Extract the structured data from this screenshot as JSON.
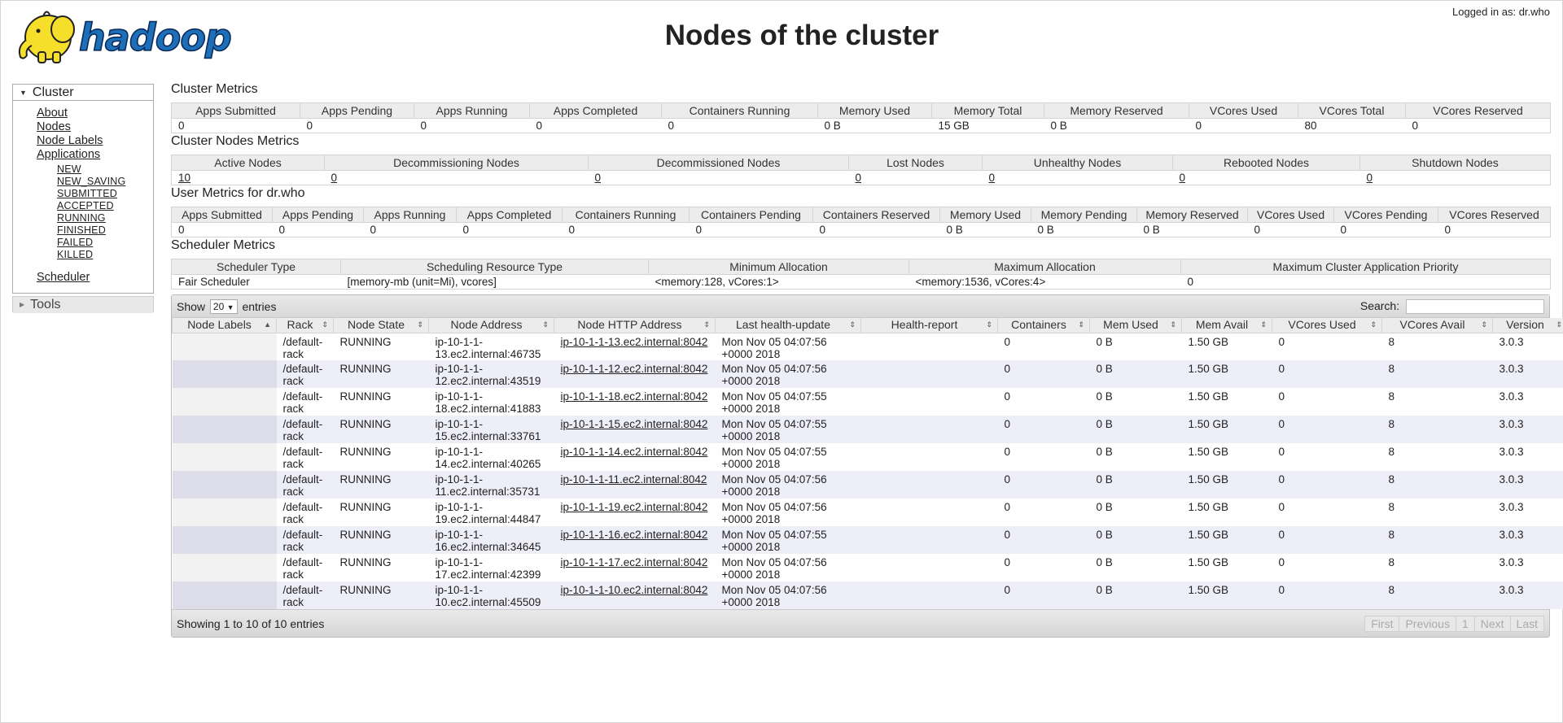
{
  "header": {
    "logo_text": "hadoop",
    "title": "Nodes of the cluster",
    "logged_in": "Logged in as: dr.who"
  },
  "sidebar": {
    "cluster_label": "Cluster",
    "items": [
      "About",
      "Nodes",
      "Node Labels",
      "Applications"
    ],
    "app_states": [
      "NEW",
      "NEW_SAVING",
      "SUBMITTED",
      "ACCEPTED",
      "RUNNING",
      "FINISHED",
      "FAILED",
      "KILLED"
    ],
    "scheduler_label": "Scheduler",
    "tools_label": "Tools"
  },
  "cluster_metrics": {
    "title": "Cluster Metrics",
    "headers": [
      "Apps Submitted",
      "Apps Pending",
      "Apps Running",
      "Apps Completed",
      "Containers Running",
      "Memory Used",
      "Memory Total",
      "Memory Reserved",
      "VCores Used",
      "VCores Total",
      "VCores Reserved"
    ],
    "values": [
      "0",
      "0",
      "0",
      "0",
      "0",
      "0 B",
      "15 GB",
      "0 B",
      "0",
      "80",
      "0"
    ]
  },
  "node_metrics": {
    "title": "Cluster Nodes Metrics",
    "headers": [
      "Active Nodes",
      "Decommissioning Nodes",
      "Decommissioned Nodes",
      "Lost Nodes",
      "Unhealthy Nodes",
      "Rebooted Nodes",
      "Shutdown Nodes"
    ],
    "values": [
      "10",
      "0",
      "0",
      "0",
      "0",
      "0",
      "0"
    ]
  },
  "user_metrics": {
    "title": "User Metrics for dr.who",
    "headers": [
      "Apps Submitted",
      "Apps Pending",
      "Apps Running",
      "Apps Completed",
      "Containers Running",
      "Containers Pending",
      "Containers Reserved",
      "Memory Used",
      "Memory Pending",
      "Memory Reserved",
      "VCores Used",
      "VCores Pending",
      "VCores Reserved"
    ],
    "values": [
      "0",
      "0",
      "0",
      "0",
      "0",
      "0",
      "0",
      "0 B",
      "0 B",
      "0 B",
      "0",
      "0",
      "0"
    ]
  },
  "scheduler_metrics": {
    "title": "Scheduler Metrics",
    "headers": [
      "Scheduler Type",
      "Scheduling Resource Type",
      "Minimum Allocation",
      "Maximum Allocation",
      "Maximum Cluster Application Priority"
    ],
    "values": [
      "Fair Scheduler",
      "[memory-mb (unit=Mi), vcores]",
      "<memory:128, vCores:1>",
      "<memory:1536, vCores:4>",
      "0"
    ]
  },
  "table": {
    "show_label": "Show",
    "entries_count": "20",
    "entries_label": "entries",
    "search_label": "Search:",
    "headers": [
      "Node Labels",
      "Rack",
      "Node State",
      "Node Address",
      "Node HTTP Address",
      "Last health-update",
      "Health-report",
      "Containers",
      "Mem Used",
      "Mem Avail",
      "VCores Used",
      "VCores Avail",
      "Version"
    ],
    "rows": [
      {
        "labels": "",
        "rack": "/default-rack",
        "state": "RUNNING",
        "addr": "ip-10-1-1-13.ec2.internal:46735",
        "http": "ip-10-1-1-13.ec2.internal:8042",
        "health": "Mon Nov 05 04:07:56 +0000 2018",
        "report": "",
        "containers": "0",
        "mem_used": "0 B",
        "mem_avail": "1.50 GB",
        "vc_used": "0",
        "vc_avail": "8",
        "version": "3.0.3"
      },
      {
        "labels": "",
        "rack": "/default-rack",
        "state": "RUNNING",
        "addr": "ip-10-1-1-12.ec2.internal:43519",
        "http": "ip-10-1-1-12.ec2.internal:8042",
        "health": "Mon Nov 05 04:07:56 +0000 2018",
        "report": "",
        "containers": "0",
        "mem_used": "0 B",
        "mem_avail": "1.50 GB",
        "vc_used": "0",
        "vc_avail": "8",
        "version": "3.0.3"
      },
      {
        "labels": "",
        "rack": "/default-rack",
        "state": "RUNNING",
        "addr": "ip-10-1-1-18.ec2.internal:41883",
        "http": "ip-10-1-1-18.ec2.internal:8042",
        "health": "Mon Nov 05 04:07:55 +0000 2018",
        "report": "",
        "containers": "0",
        "mem_used": "0 B",
        "mem_avail": "1.50 GB",
        "vc_used": "0",
        "vc_avail": "8",
        "version": "3.0.3"
      },
      {
        "labels": "",
        "rack": "/default-rack",
        "state": "RUNNING",
        "addr": "ip-10-1-1-15.ec2.internal:33761",
        "http": "ip-10-1-1-15.ec2.internal:8042",
        "health": "Mon Nov 05 04:07:55 +0000 2018",
        "report": "",
        "containers": "0",
        "mem_used": "0 B",
        "mem_avail": "1.50 GB",
        "vc_used": "0",
        "vc_avail": "8",
        "version": "3.0.3"
      },
      {
        "labels": "",
        "rack": "/default-rack",
        "state": "RUNNING",
        "addr": "ip-10-1-1-14.ec2.internal:40265",
        "http": "ip-10-1-1-14.ec2.internal:8042",
        "health": "Mon Nov 05 04:07:55 +0000 2018",
        "report": "",
        "containers": "0",
        "mem_used": "0 B",
        "mem_avail": "1.50 GB",
        "vc_used": "0",
        "vc_avail": "8",
        "version": "3.0.3"
      },
      {
        "labels": "",
        "rack": "/default-rack",
        "state": "RUNNING",
        "addr": "ip-10-1-1-11.ec2.internal:35731",
        "http": "ip-10-1-1-11.ec2.internal:8042",
        "health": "Mon Nov 05 04:07:56 +0000 2018",
        "report": "",
        "containers": "0",
        "mem_used": "0 B",
        "mem_avail": "1.50 GB",
        "vc_used": "0",
        "vc_avail": "8",
        "version": "3.0.3"
      },
      {
        "labels": "",
        "rack": "/default-rack",
        "state": "RUNNING",
        "addr": "ip-10-1-1-19.ec2.internal:44847",
        "http": "ip-10-1-1-19.ec2.internal:8042",
        "health": "Mon Nov 05 04:07:56 +0000 2018",
        "report": "",
        "containers": "0",
        "mem_used": "0 B",
        "mem_avail": "1.50 GB",
        "vc_used": "0",
        "vc_avail": "8",
        "version": "3.0.3"
      },
      {
        "labels": "",
        "rack": "/default-rack",
        "state": "RUNNING",
        "addr": "ip-10-1-1-16.ec2.internal:34645",
        "http": "ip-10-1-1-16.ec2.internal:8042",
        "health": "Mon Nov 05 04:07:55 +0000 2018",
        "report": "",
        "containers": "0",
        "mem_used": "0 B",
        "mem_avail": "1.50 GB",
        "vc_used": "0",
        "vc_avail": "8",
        "version": "3.0.3"
      },
      {
        "labels": "",
        "rack": "/default-rack",
        "state": "RUNNING",
        "addr": "ip-10-1-1-17.ec2.internal:42399",
        "http": "ip-10-1-1-17.ec2.internal:8042",
        "health": "Mon Nov 05 04:07:56 +0000 2018",
        "report": "",
        "containers": "0",
        "mem_used": "0 B",
        "mem_avail": "1.50 GB",
        "vc_used": "0",
        "vc_avail": "8",
        "version": "3.0.3"
      },
      {
        "labels": "",
        "rack": "/default-rack",
        "state": "RUNNING",
        "addr": "ip-10-1-1-10.ec2.internal:45509",
        "http": "ip-10-1-1-10.ec2.internal:8042",
        "health": "Mon Nov 05 04:07:56 +0000 2018",
        "report": "",
        "containers": "0",
        "mem_used": "0 B",
        "mem_avail": "1.50 GB",
        "vc_used": "0",
        "vc_avail": "8",
        "version": "3.0.3"
      }
    ],
    "info": "Showing 1 to 10 of 10 entries",
    "pager": [
      "First",
      "Previous",
      "1",
      "Next",
      "Last"
    ]
  },
  "colors": {
    "logo_yellow": "#f6df2b",
    "logo_blue": "#1d70b8",
    "header_bg": "#ececec",
    "row_alt": "#eeeef8"
  }
}
